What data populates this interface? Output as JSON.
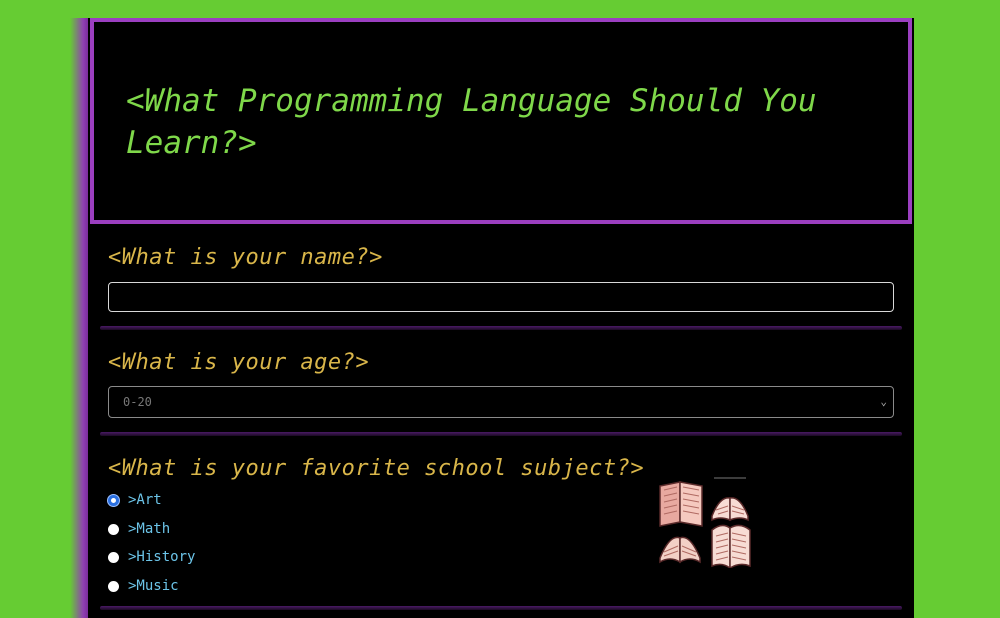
{
  "header": {
    "title": "<What Programming Language Should You Learn?>"
  },
  "questions": {
    "name": {
      "label": "<What is your name?>",
      "value": ""
    },
    "age": {
      "label": "<What is your age?>",
      "selected": "0-20"
    },
    "subject": {
      "label": "<What is your favorite school subject?>",
      "options": [
        {
          "label": ">Art",
          "checked": true
        },
        {
          "label": ">Math",
          "checked": false
        },
        {
          "label": ">History",
          "checked": false
        },
        {
          "label": ">Music",
          "checked": false
        }
      ],
      "image_icon": "open-books-icon"
    }
  },
  "colors": {
    "page_bg": "#66cc33",
    "card_bg": "#000000",
    "header_border": "#9b3fc0",
    "title_text": "#7fd84a",
    "question_text": "#d9b64a",
    "option_text": "#6cc4e8"
  }
}
